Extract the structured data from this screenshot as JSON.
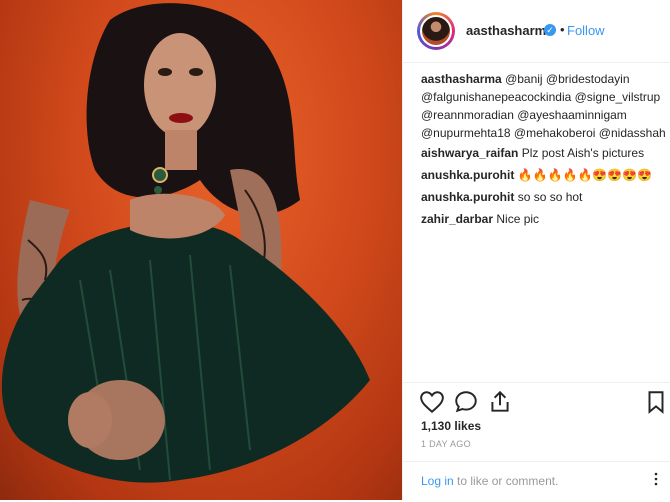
{
  "post": {
    "username": "aasthasharma",
    "verified_glyph": "✓",
    "separator": "•",
    "follow_label": "Follow",
    "caption": {
      "author": "aasthasharma",
      "lines": [
        "@banij @bridestodayin",
        "@falgunishanepeacockindia @signe_vilstrup",
        "@reannmoradian @ayeshaaminnigam",
        "@nupurmehta18 @mehakoberoi @nidasshah"
      ]
    },
    "comments": [
      {
        "author": "aishwarya_raifan",
        "text": "Plz post Aish's pictures"
      },
      {
        "author": "anushka.purohit",
        "text": "🔥🔥🔥🔥🔥😍😍😍😍"
      },
      {
        "author": "anushka.purohit",
        "text": "so so so hot"
      },
      {
        "author": "zahir_darbar",
        "text": "Nice pic"
      }
    ],
    "likes": "1,130 likes",
    "time": "1 DAY AGO",
    "login": {
      "link": "Log in",
      "rest": " to like or comment."
    }
  },
  "icons": {
    "like": "heart-icon",
    "comment": "comment-icon",
    "share": "share-icon",
    "save": "bookmark-icon"
  },
  "colors": {
    "link": "#3897f0",
    "text": "#262626",
    "muted": "#999999",
    "photo_background": "#d24a1c"
  }
}
